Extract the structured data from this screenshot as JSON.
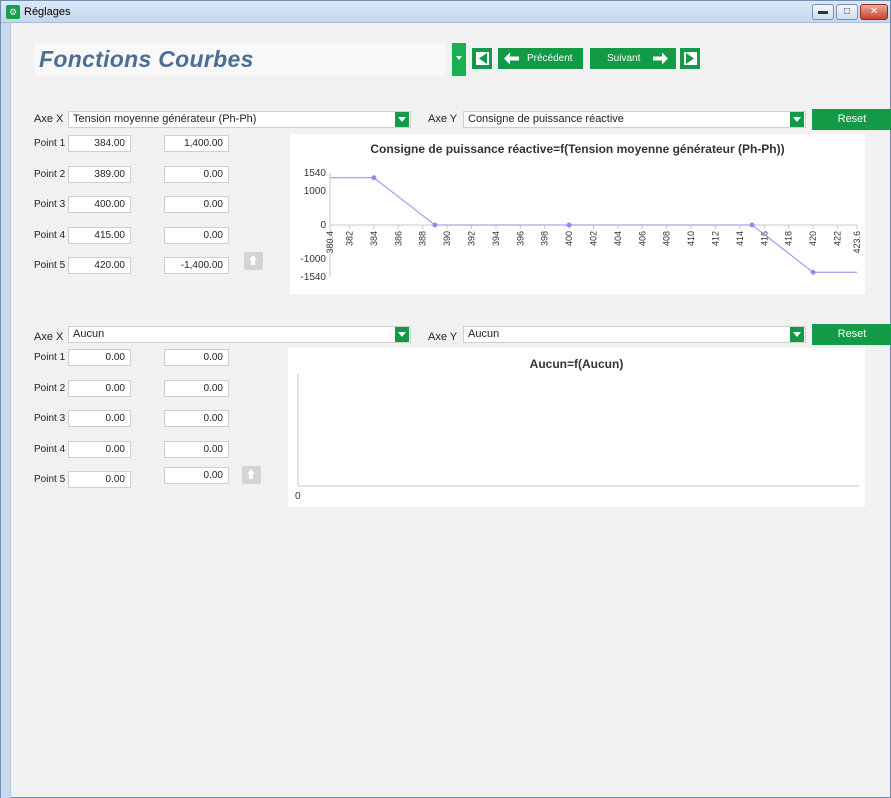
{
  "window": {
    "title": "Réglages"
  },
  "header": {
    "title": "Fonctions Courbes"
  },
  "nav": {
    "prev_label": "Précédent",
    "next_label": "Suivant"
  },
  "section1": {
    "axe_x_label": "Axe X",
    "axe_x_value": "Tension moyenne générateur (Ph-Ph)",
    "axe_y_label": "Axe Y",
    "axe_y_value": "Consigne de puissance réactive",
    "reset_label": "Reset",
    "points": [
      {
        "label": "Point 1",
        "x": "384.00",
        "y": "1,400.00"
      },
      {
        "label": "Point 2",
        "x": "389.00",
        "y": "0.00"
      },
      {
        "label": "Point 3",
        "x": "400.00",
        "y": "0.00"
      },
      {
        "label": "Point 4",
        "x": "415.00",
        "y": "0.00"
      },
      {
        "label": "Point 5",
        "x": "420.00",
        "y": "-1,400.00"
      }
    ]
  },
  "section2": {
    "axe_x_label": "Axe X",
    "axe_x_value": "Aucun",
    "axe_y_label": "Axe Y",
    "axe_y_value": "Aucun",
    "reset_label": "Reset",
    "points": [
      {
        "label": "Point 1",
        "x": "0.00",
        "y": "0.00"
      },
      {
        "label": "Point 2",
        "x": "0.00",
        "y": "0.00"
      },
      {
        "label": "Point 3",
        "x": "0.00",
        "y": "0.00"
      },
      {
        "label": "Point 4",
        "x": "0.00",
        "y": "0.00"
      },
      {
        "label": "Point 5",
        "x": "0.00",
        "y": "0.00"
      }
    ]
  },
  "chart_data": [
    {
      "type": "line",
      "title": "Consigne de puissance réactive=f(Tension moyenne générateur (Ph-Ph))",
      "x": [
        380.4,
        384,
        389,
        400,
        415,
        420,
        423.6
      ],
      "y": [
        1400,
        1400,
        0,
        0,
        0,
        -1400,
        -1400
      ],
      "markers_x": [
        384,
        389,
        400,
        415,
        420
      ],
      "markers_y": [
        1400,
        0,
        0,
        0,
        -1400
      ],
      "xlim": [
        380.4,
        423.6
      ],
      "ylim": [
        -1540,
        1540
      ],
      "x_ticks": [
        "380.4",
        "382",
        "384",
        "386",
        "388",
        "390",
        "392",
        "394",
        "396",
        "398",
        "400",
        "402",
        "404",
        "406",
        "408",
        "410",
        "412",
        "414",
        "416",
        "418",
        "420",
        "422",
        "423.6"
      ],
      "y_ticks": [
        "1540",
        "1000",
        "0",
        "-1000",
        "-1540"
      ],
      "color": "#8f8fe6"
    },
    {
      "type": "line",
      "title": "Aucun=f(Aucun)",
      "x": [],
      "y": [],
      "x_ticks": [
        "0"
      ]
    }
  ]
}
